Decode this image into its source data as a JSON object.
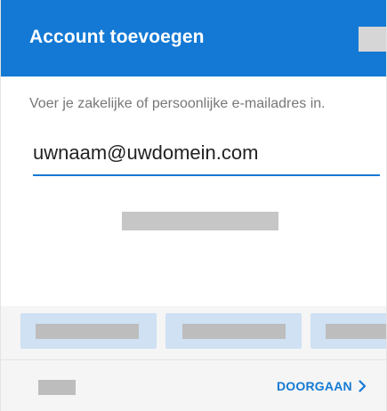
{
  "header": {
    "title": "Account toevoegen",
    "action_icon": "redacted-icon"
  },
  "form": {
    "prompt": "Voer je zakelijke of persoonlijke e-mailadres in.",
    "email_placeholder": "uwnaam@uwdomein.com",
    "email_value": ""
  },
  "footer": {
    "continue_label": "DOORGAAN",
    "continue_icon": "chevron-right-icon"
  },
  "colors": {
    "accent": "#1479d4",
    "provider_tile": "#cfe1f3",
    "redaction": "#bdbdbd"
  }
}
